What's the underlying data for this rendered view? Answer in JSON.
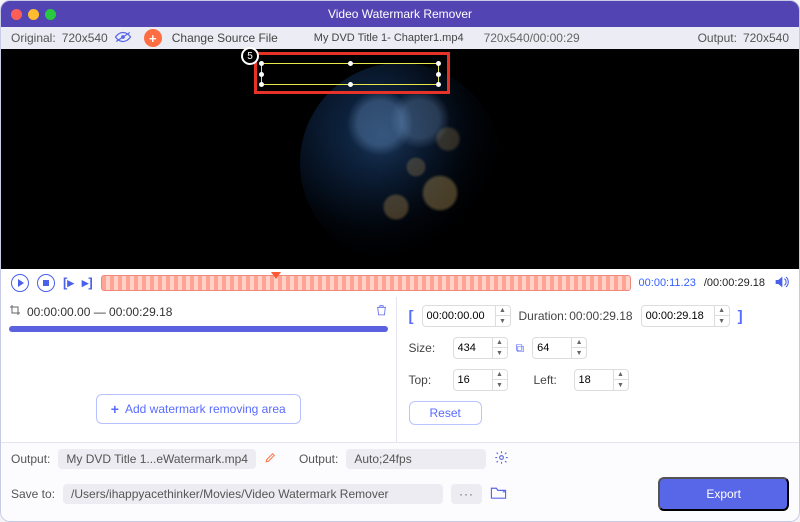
{
  "window": {
    "title": "Video Watermark Remover"
  },
  "infobar": {
    "originalLabel": "Original:",
    "originalRes": "720x540",
    "changeSource": "Change Source File",
    "filename": "My DVD Title 1- Chapter1.mp4",
    "resAndDur": "720x540/00:00:29",
    "outputLabel": "Output:",
    "outputRes": "720x540"
  },
  "stepBadge": "5",
  "playbar": {
    "current": "00:00:11.23",
    "total": "/00:00:29.18"
  },
  "segment": {
    "range": "00:00:00.00 — 00:00:29.18"
  },
  "addArea": "Add watermark removing area",
  "range": {
    "start": "00:00:00.00",
    "durationLabel": "Duration:",
    "durationVal": "00:00:29.18",
    "end": "00:00:29.18"
  },
  "size": {
    "label": "Size:",
    "w": "434",
    "h": "64"
  },
  "pos": {
    "topLabel": "Top:",
    "top": "16",
    "leftLabel": "Left:",
    "left": "18"
  },
  "reset": "Reset",
  "footer": {
    "outputLabel": "Output:",
    "outputFile": "My DVD Title 1...eWatermark.mp4",
    "outputSettingsLabel": "Output:",
    "outputSettings": "Auto;24fps",
    "saveToLabel": "Save to:",
    "saveToPath": "/Users/ihappyacethinker/Movies/Video Watermark Remover",
    "export": "Export"
  }
}
